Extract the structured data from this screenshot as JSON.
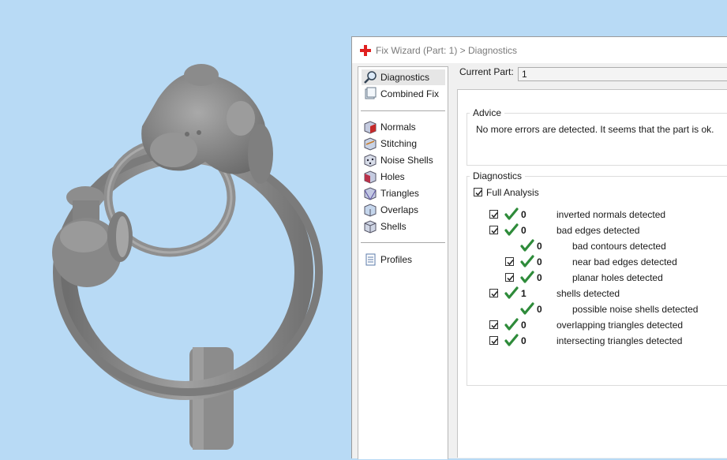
{
  "dialog": {
    "title": "Fix Wizard (Part: 1) > Diagnostics"
  },
  "nav": {
    "items": [
      {
        "label": "Diagnostics",
        "icon": "magnifier-icon",
        "selected": true
      },
      {
        "label": "Combined Fix",
        "icon": "combined-fix-icon"
      },
      {
        "label": "Normals",
        "icon": "normals-cube-icon"
      },
      {
        "label": "Stitching",
        "icon": "stitching-cube-icon"
      },
      {
        "label": "Noise Shells",
        "icon": "noise-shells-dice-icon"
      },
      {
        "label": "Holes",
        "icon": "holes-cube-icon"
      },
      {
        "label": "Triangles",
        "icon": "triangles-cube-icon"
      },
      {
        "label": "Overlaps",
        "icon": "overlaps-cube-icon"
      },
      {
        "label": "Shells",
        "icon": "shells-cube-icon"
      },
      {
        "label": "Profiles",
        "icon": "profiles-document-icon"
      }
    ]
  },
  "current_part": {
    "label": "Current Part:",
    "value": "1"
  },
  "advice": {
    "title": "Advice",
    "text": "No more errors are detected. It seems that the part is ok."
  },
  "diagnostics": {
    "title": "Diagnostics",
    "full_analysis_label": "Full Analysis",
    "full_analysis_checked": true,
    "rows": [
      {
        "checkbox": true,
        "count": "0",
        "label": "inverted normals detected",
        "indent": 0
      },
      {
        "checkbox": true,
        "count": "0",
        "label": "bad edges detected",
        "indent": 0
      },
      {
        "checkbox": false,
        "count": "0",
        "label": "bad contours detected",
        "indent": 1
      },
      {
        "checkbox": true,
        "count": "0",
        "label": "near bad edges detected",
        "indent": 1
      },
      {
        "checkbox": true,
        "count": "0",
        "label": "planar holes detected",
        "indent": 1
      },
      {
        "checkbox": true,
        "count": "1",
        "label": "shells detected",
        "indent": 0
      },
      {
        "checkbox": false,
        "count": "0",
        "label": "possible noise shells detected",
        "indent": 1
      },
      {
        "checkbox": true,
        "count": "0",
        "label": "overlapping triangles detected",
        "indent": 0
      },
      {
        "checkbox": true,
        "count": "0",
        "label": "intersecting triangles detected",
        "indent": 0
      }
    ]
  },
  "colors": {
    "viewport_background": "#b8daf5",
    "model_gray": "#8a8a8a",
    "check_green": "#2e8b3a",
    "title_red": "#e02020"
  }
}
